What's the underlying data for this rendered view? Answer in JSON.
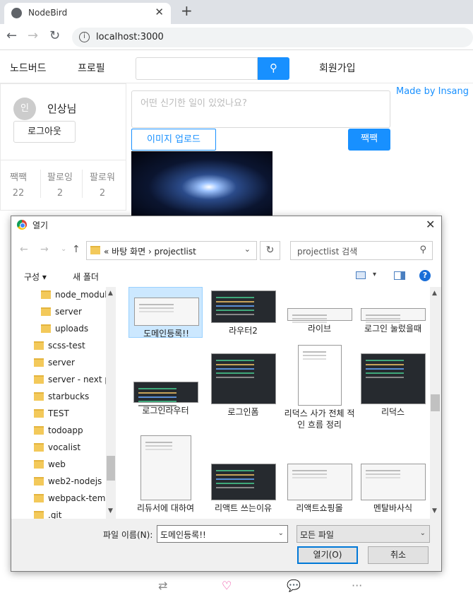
{
  "browser": {
    "tab_title": "NodeBird",
    "tab_close": "✕",
    "new_tab": "+",
    "back": "←",
    "forward": "→",
    "reload": "↻",
    "info": "i",
    "url": "localhost:3000"
  },
  "menu": {
    "home": "노드버드",
    "profile": "프로필",
    "search_icon": "⚲",
    "signup": "회원가입"
  },
  "user": {
    "avatar_initial": "인",
    "nickname": "인상님",
    "logout_label": "로그아웃",
    "stats": [
      {
        "label": "짹짹",
        "value": "22"
      },
      {
        "label": "팔로잉",
        "value": "2"
      },
      {
        "label": "팔로워",
        "value": "2"
      }
    ]
  },
  "made_by": "Made by Insang",
  "post_form": {
    "placeholder": "어떤 신기한 일이 있었나요?",
    "upload_label": "이미지 업로드",
    "submit_label": "짹짹"
  },
  "post_actions": [
    "⇄",
    "♡",
    "💬",
    "···"
  ],
  "dialog": {
    "title": "열기",
    "close": "✕",
    "nav": {
      "back": "←",
      "forward": "→",
      "recent": "⌄",
      "up": "↑"
    },
    "path": "« 바탕 화면  ›  projectlist",
    "path_dropdown": "⌄",
    "refresh": "↻",
    "search_placeholder": "projectlist 검색",
    "search_icon": "⚲",
    "organize_label": "구성 ▾",
    "new_folder_label": "새 폴더",
    "view_dropdown": "▾",
    "help": "?",
    "scroll_up": "▲",
    "scroll_down": "▼",
    "tree": [
      "node_module",
      "server",
      "uploads",
      "scss-test",
      "server",
      "server - next p",
      "starbucks",
      "TEST",
      "todoapp",
      "vocalist",
      "web",
      "web2-nodejs",
      "webpack-temp",
      ".git"
    ],
    "files": [
      {
        "name": "도메인등록!!",
        "style": "light"
      },
      {
        "name": "라우터2",
        "style": "dark"
      },
      {
        "name": "라이브",
        "style": "light"
      },
      {
        "name": "로그인 눌렀을때",
        "style": "light"
      },
      {
        "name": "로그인라우터",
        "style": "dark"
      },
      {
        "name": "로그인폼",
        "style": "dark"
      },
      {
        "name": "리덕스 사가 전체 적인 흐름 정리",
        "style": "doc"
      },
      {
        "name": "리덕스",
        "style": "dark"
      },
      {
        "name": "리듀서에 대하여",
        "style": "light"
      },
      {
        "name": "리액트 쓰는이유",
        "style": "dark"
      },
      {
        "name": "리액트쇼핑몰",
        "style": "light"
      },
      {
        "name": "멘탈바사식",
        "style": "light"
      }
    ],
    "filename_label": "파일 이름(N):",
    "filename_value": "도메인등록!!",
    "dropdown_arrow": "⌄",
    "filetype_value": "모든 파일",
    "open_label": "열기(O)",
    "cancel_label": "취소"
  }
}
